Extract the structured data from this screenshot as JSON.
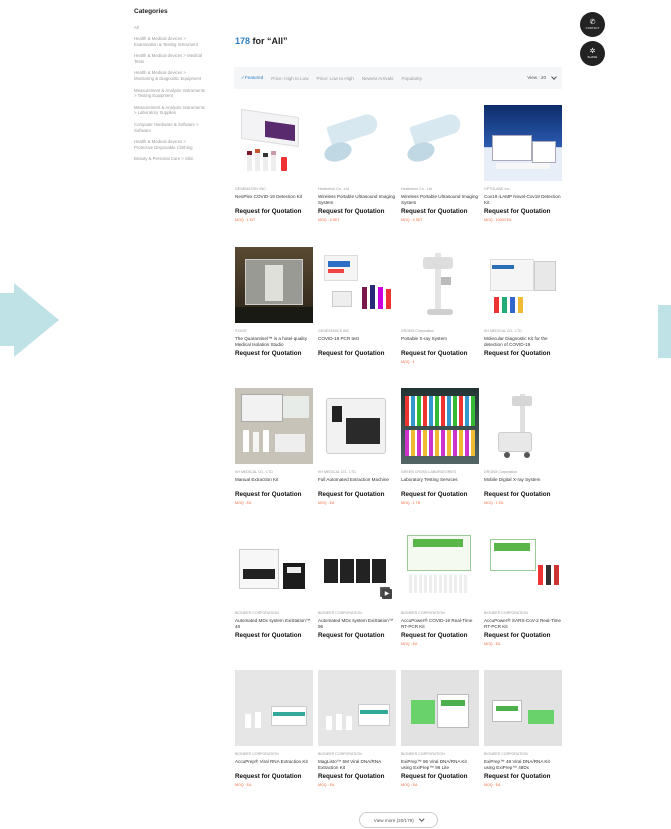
{
  "sidebar": {
    "heading": "Categories",
    "items": [
      "All",
      "Health & Medical devices > Examination & Testing Instrument",
      "Health & Medical devices > Medical Tests",
      "Health & Medical devices > Monitoring & Diagnostic Equipment",
      "Measurement & Analysis Instruments > Testing Equipment",
      "Measurement & Analysis Instruments > Laboratory Supplies",
      "Computer Hardware & Software > Software",
      "Health & Medical devices > Protective Disposable Clothing",
      "Beauty & Personal Care > Skin"
    ]
  },
  "results": {
    "count": "178",
    "suffix": " for “All”"
  },
  "sortbar": {
    "options": [
      "Featured",
      "Price: High to Low",
      "Price: Low to High",
      "Newest Arrivals",
      "Popularity"
    ],
    "active_marker": "✓",
    "view": "View : 20"
  },
  "fab": {
    "contact": {
      "glyph": "✆",
      "label": "CONTACT"
    },
    "share": {
      "glyph": "✲",
      "label": "SHARE"
    }
  },
  "products": [
    {
      "company": "GENEMATRIX INC.",
      "name": "NeoPlex COVID-19 Detection Kit",
      "rfq": "Request for Quotation",
      "moq": "MOQ : 1 KIT"
    },
    {
      "company": "Healcerion Co., Ltd",
      "name": "Wireless Portable Ultrasound Imaging System",
      "rfq": "Request for Quotation",
      "moq": "MOQ : 4 SET"
    },
    {
      "company": "Healcerion Co., Ltd",
      "name": "Wireless Portable Ultrasound Imaging System",
      "rfq": "Request for Quotation",
      "moq": "MOQ : 4 SET"
    },
    {
      "company": "OPTOLANE Inc.",
      "name": "Cov19 iLAMP Novel-Cov19 Detection Kit",
      "rfq": "Request for Quotation",
      "moq": "MOQ : 10000 EA"
    },
    {
      "company": "STAGE",
      "name": "The Quarantinel™ is a hotel-quality Medical Isolation Studio",
      "rfq": "Request for Quotation",
      "moq": ""
    },
    {
      "company": "GENESEMICS INC.",
      "name": "COVID-19 PCR test",
      "rfq": "Request for Quotation",
      "moq": ""
    },
    {
      "company": "DRGEM Corporation",
      "name": "Portable X-ray System",
      "rfq": "Request for Quotation",
      "moq": "MOQ : 1"
    },
    {
      "company": "KH MEDICAL CO., LTD.",
      "name": "Molecular Diagnostic Kit for the detection of COVID-19",
      "rfq": "Request for Quotation",
      "moq": ""
    },
    {
      "company": "KH MEDICAL CO., LTD.",
      "name": "Manual Extraction Kit",
      "rfq": "Request for Quotation",
      "moq": "MOQ : EA"
    },
    {
      "company": "KH MEDICAL CO., LTD.",
      "name": "Full Automated Extraction Machine",
      "rfq": "Request for Quotation",
      "moq": "MOQ : EA"
    },
    {
      "company": "GREEN CROSS LABORATORIES",
      "name": "Laboratory Testing Services",
      "rfq": "Request for Quotation",
      "moq": "MOQ : 1 TB"
    },
    {
      "company": "DRGEM Corporation",
      "name": "Mobile Digital X-ray System",
      "rfq": "Request for Quotation",
      "moq": "MOQ : 1 EA"
    },
    {
      "company": "BIONEER CORPORATION",
      "name": "Automated MDx system ExiStation™ 48",
      "rfq": "Request for Quotation",
      "moq": ""
    },
    {
      "company": "BIONEER CORPORATION",
      "name": "Automated MDx system ExiStation™ 96",
      "rfq": "Request for Quotation",
      "moq": ""
    },
    {
      "company": "BIONEER CORPORATION",
      "name": "AccuPower® COVID-19 Real-Time RT-PCR Kit",
      "rfq": "Request for Quotation",
      "moq": "MOQ : EA"
    },
    {
      "company": "BIONEER CORPORATION",
      "name": "AccuPower® SARS-CoV-2 Real-Time RT-PCR Kit",
      "rfq": "Request for Quotation",
      "moq": "MOQ : EA"
    },
    {
      "company": "BIONEER CORPORATION",
      "name": "AccuPrep® Viral RNA Extraction Kit",
      "rfq": "Request for Quotation",
      "moq": "MOQ : EA"
    },
    {
      "company": "BIONEER CORPORATION",
      "name": "MagListo™ 5M Viral DNA/RNA Extraction Kit",
      "rfq": "Request for Quotation",
      "moq": "MOQ : EA"
    },
    {
      "company": "BIONEER CORPORATION",
      "name": "ExiPrep™ 96 Viral DNA/RNA Kit using ExiPrep™ 96 Lite",
      "rfq": "Request for Quotation",
      "moq": "MOQ : EA"
    },
    {
      "company": "BIONEER CORPORATION",
      "name": "ExiPrep™ 48 Viral DNA/RNA Kit using ExiPrep™ 48Dx",
      "rfq": "Request for Quotation",
      "moq": "MOQ : EA"
    }
  ],
  "view_more": "View more (20/178)"
}
